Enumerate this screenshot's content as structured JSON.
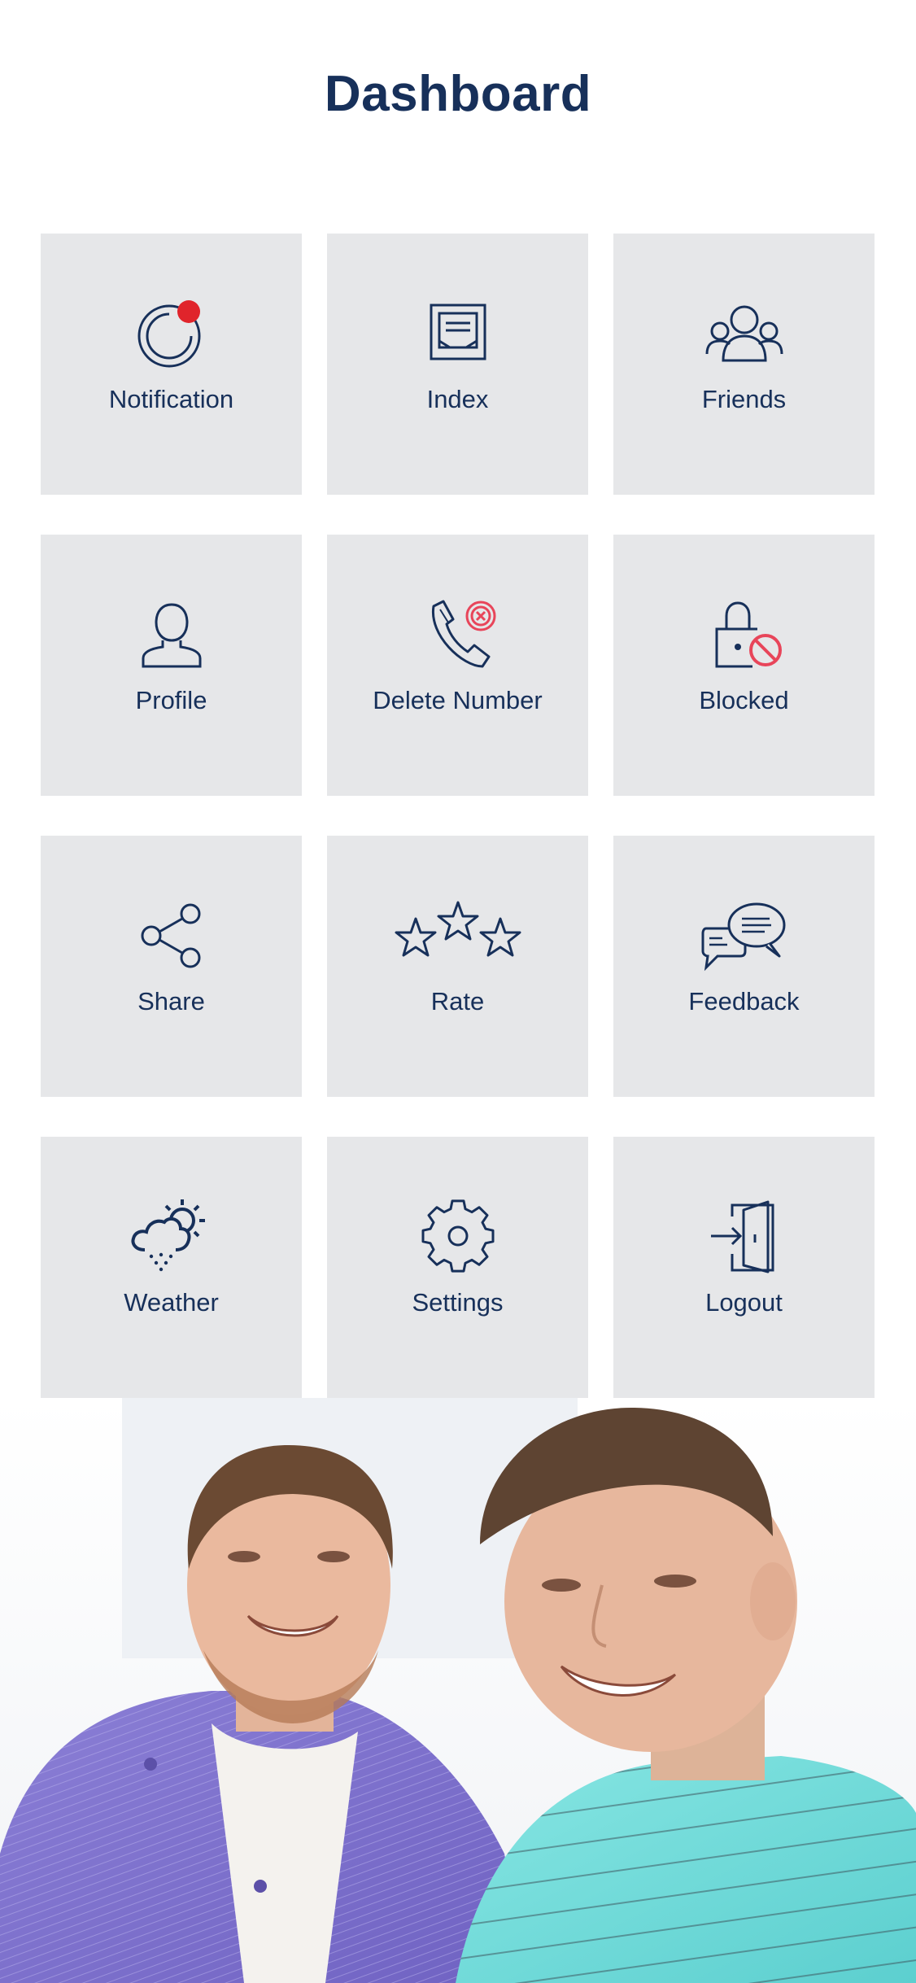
{
  "header": {
    "title": "Dashboard"
  },
  "colors": {
    "navy": "#17305a",
    "tile_bg": "#e6e7e9",
    "alert_red": "#e0242b",
    "prohibit_red": "#e8455a"
  },
  "tiles": [
    {
      "label": "Notification",
      "icon": "notification-icon"
    },
    {
      "label": "Index",
      "icon": "index-icon"
    },
    {
      "label": "Friends",
      "icon": "friends-icon"
    },
    {
      "label": "Profile",
      "icon": "profile-icon"
    },
    {
      "label": "Delete Number",
      "icon": "delete-number-icon"
    },
    {
      "label": "Blocked",
      "icon": "blocked-icon"
    },
    {
      "label": "Share",
      "icon": "share-icon"
    },
    {
      "label": "Rate",
      "icon": "rate-icon"
    },
    {
      "label": "Feedback",
      "icon": "feedback-icon"
    },
    {
      "label": "Weather",
      "icon": "weather-icon"
    },
    {
      "label": "Settings",
      "icon": "settings-icon"
    },
    {
      "label": "Logout",
      "icon": "logout-icon"
    }
  ],
  "banner": {
    "image": "two-men-smiling-photo"
  }
}
